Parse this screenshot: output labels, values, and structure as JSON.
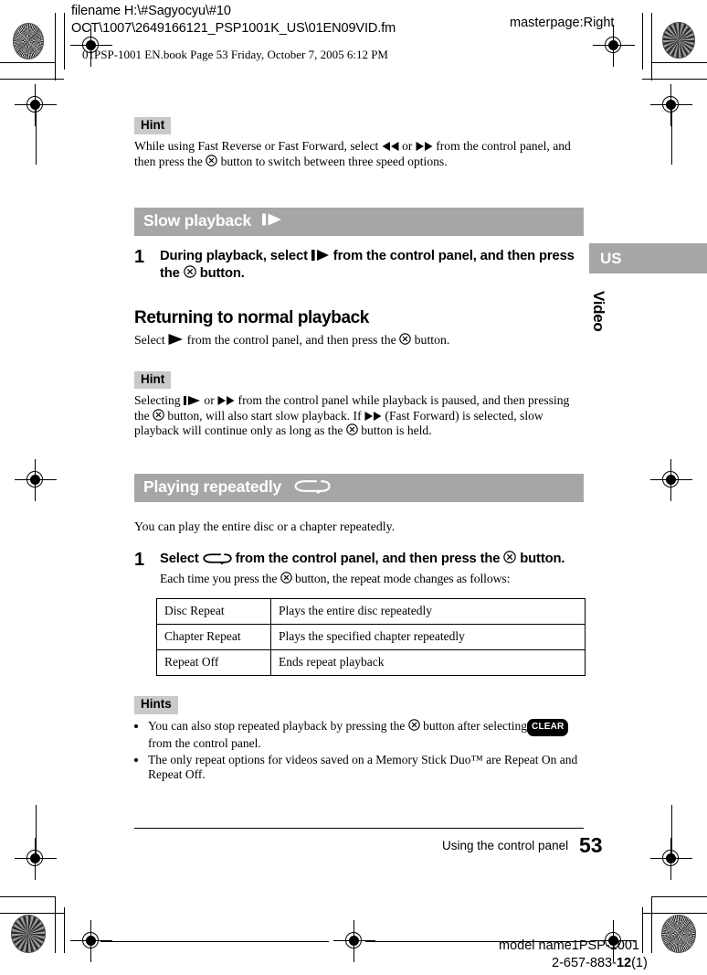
{
  "header": {
    "filename_line1": "filename H:\\#Sagyocyu\\#10",
    "filename_line2": "OCT\\1007\\2649166121_PSP1001K_US\\01EN09VID.fm",
    "masterpage": "masterpage:Right",
    "bookline": "01PSP-1001 EN.book  Page 53  Friday, October 7, 2005  6:12 PM"
  },
  "hint_top": {
    "badge": "Hint",
    "text_a": "While using Fast Reverse or Fast Forward, select",
    "text_b": "or",
    "text_c": "from the control panel, and then press the",
    "text_d": "button to switch between three speed options."
  },
  "slow_playback": {
    "heading": "Slow playback",
    "step_number": "1",
    "step_a": "During playback, select",
    "step_b": "from the control panel, and then press the",
    "step_c": "button."
  },
  "returning": {
    "heading": "Returning to normal playback",
    "text_a": "Select",
    "text_b": "from the control panel, and then press the",
    "text_c": "button."
  },
  "hint_slow": {
    "badge": "Hint",
    "text_a": "Selecting",
    "text_b": "or",
    "text_c": "from the control panel while playback is paused, and then pressing the",
    "text_d": "button, will also start slow playback. If",
    "text_e": "(Fast Forward) is selected, slow playback will continue only as long as the",
    "text_f": "button is held."
  },
  "playing_repeatedly": {
    "heading": "Playing repeatedly",
    "intro": "You can play the entire disc or a chapter repeatedly.",
    "step_number": "1",
    "step_a": "Select",
    "step_b": "from the control panel, and then press the",
    "step_c": "button.",
    "step_sub": "Each time you press the",
    "step_sub_b": "button, the repeat mode changes as follows:",
    "table": [
      {
        "mode": "Disc Repeat",
        "description": "Plays the entire disc repeatedly"
      },
      {
        "mode": "Chapter Repeat",
        "description": "Plays the specified chapter repeatedly"
      },
      {
        "mode": "Repeat Off",
        "description": "Ends repeat playback"
      }
    ]
  },
  "hints_bottom": {
    "badge": "Hints",
    "item1_a": "You can also stop repeated playback by pressing the",
    "item1_b": "button after selecting",
    "item1_pill": "CLEAR",
    "item1_c": "from the control panel.",
    "item2": "The only repeat options for videos saved on a Memory Stick Duo™ are Repeat On and Repeat Off."
  },
  "side_tab": {
    "region": "US",
    "section": "Video"
  },
  "footer": {
    "caption": "Using the control panel",
    "page_number": "53",
    "model_name": "model name1PSP-1001",
    "doc_number_prefix": "2-657-883-",
    "doc_number_bold": "12",
    "doc_number_suffix": "(1)"
  },
  "colors": {
    "section_bar": "#a6a6a6",
    "badge": "#c9c9c9",
    "text": "#000000"
  }
}
